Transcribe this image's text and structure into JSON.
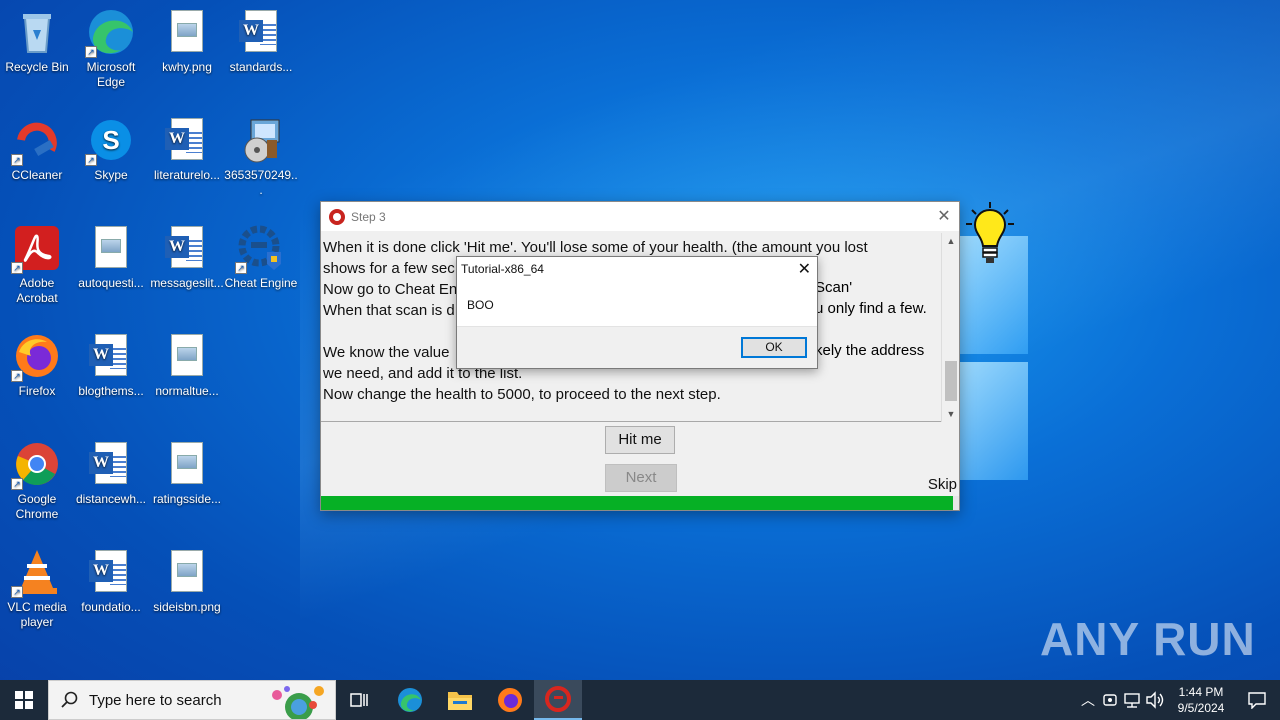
{
  "desktop": {
    "icons": [
      {
        "label": "Recycle Bin",
        "kind": "recycle"
      },
      {
        "label": "Microsoft Edge",
        "kind": "edge"
      },
      {
        "label": "kwhy.png",
        "kind": "image"
      },
      {
        "label": "standards...",
        "kind": "word"
      },
      {
        "label": "CCleaner",
        "kind": "ccleaner"
      },
      {
        "label": "Skype",
        "kind": "skype"
      },
      {
        "label": "literaturelo...",
        "kind": "word"
      },
      {
        "label": "3653570249...",
        "kind": "installer"
      },
      {
        "label": "Adobe Acrobat",
        "kind": "acrobat"
      },
      {
        "label": "autoquesti...",
        "kind": "image"
      },
      {
        "label": "messageslit...",
        "kind": "word"
      },
      {
        "label": "Cheat Engine",
        "kind": "cheatengine"
      },
      {
        "label": "Firefox",
        "kind": "firefox"
      },
      {
        "label": "blogthems...",
        "kind": "word"
      },
      {
        "label": "normaltue...",
        "kind": "image"
      },
      {
        "label": "Google Chrome",
        "kind": "chrome"
      },
      {
        "label": "distancewh...",
        "kind": "word"
      },
      {
        "label": "ratingsside...",
        "kind": "image"
      },
      {
        "label": "VLC media player",
        "kind": "vlc"
      },
      {
        "label": "foundatio...",
        "kind": "word"
      },
      {
        "label": "sideisbn.png",
        "kind": "image"
      }
    ]
  },
  "tutorial_window": {
    "title": "Step 3",
    "text_lines": [
      "When it is done click 'Hit me'. You'll lose some of your health. (the amount you lost",
      "shows for a few sec",
      "Now go to Cheat En",
      "When that scan is d",
      "",
      "We know the value",
      "we need, and add it to the list.",
      "Now change the health to 5000, to proceed to the next step."
    ],
    "text_right_fragments": [
      "Scan'",
      "u only find a few.",
      "kely the address"
    ],
    "hit_me_label": "Hit me",
    "next_label": "Next",
    "skip_label": "Skip",
    "progress": 0.99
  },
  "message_box": {
    "title": "Tutorial-x86_64",
    "body": "BOO",
    "ok_label": "OK"
  },
  "taskbar": {
    "search_placeholder": "Type here to search",
    "time": "1:44 PM",
    "date": "9/5/2024"
  },
  "watermark": "ANY RUN"
}
